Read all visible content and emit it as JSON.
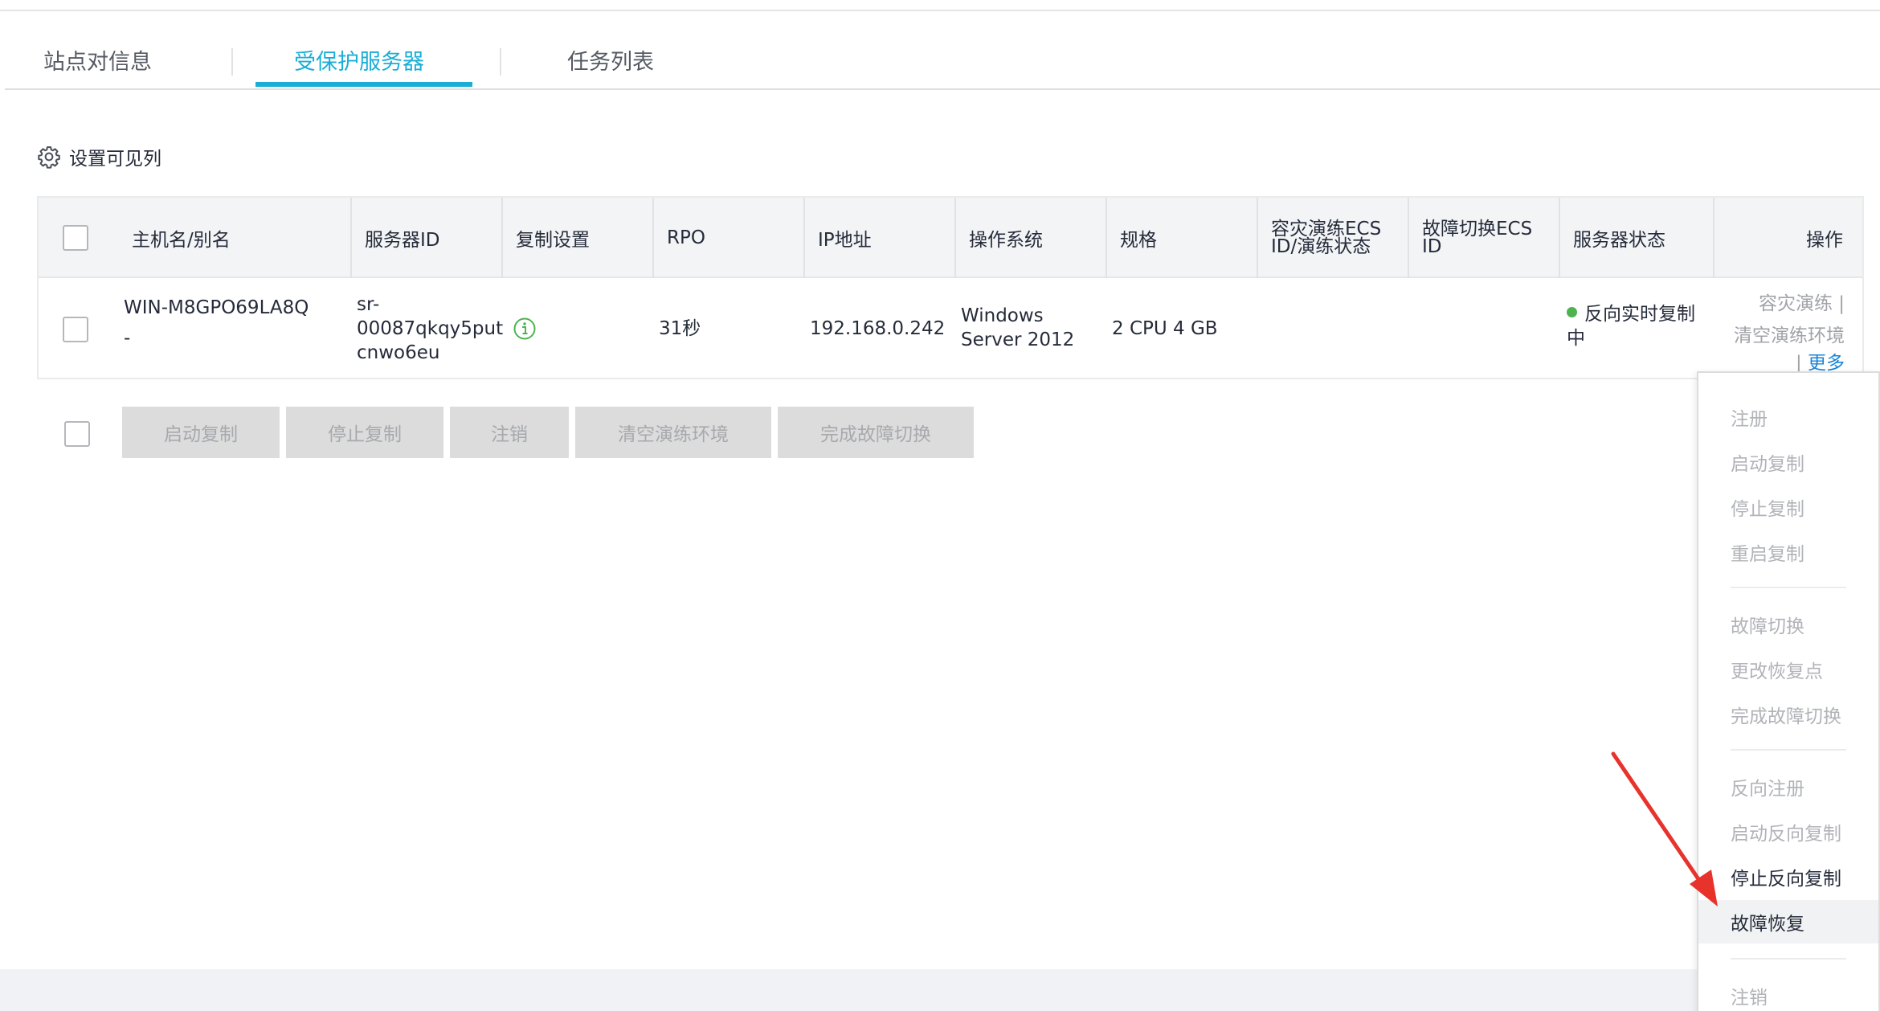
{
  "tabs": [
    {
      "label": "站点对信息"
    },
    {
      "label": "受保护服务器"
    },
    {
      "label": "任务列表"
    }
  ],
  "toolbar": {
    "settings_label": "设置可见列",
    "settings_icon": "gear-icon"
  },
  "table": {
    "headers": {
      "hostname": "主机名/别名",
      "server_id": "服务器ID",
      "replication": "复制设置",
      "rpo": "RPO",
      "ip": "IP地址",
      "os": "操作系统",
      "spec": "规格",
      "drill_ecs": "容灾演练ECS ID/演练状态",
      "failover_ecs": "故障切换ECS ID",
      "status": "服务器状态",
      "actions": "操作"
    },
    "row": {
      "hostname": "WIN-M8GPO69LA8Q",
      "alias": "-",
      "server_id_line1": "sr-",
      "server_id_line2": "00087qkqy5put",
      "server_id_line3": "cnwo6eu",
      "replication_icon": "info-icon",
      "rpo": "31秒",
      "ip": "192.168.0.242",
      "os_line1": "Windows",
      "os_line2": "Server 2012",
      "spec": "2 CPU 4 GB",
      "drill_ecs": "",
      "failover_ecs": "",
      "status_line1": "反向实时复制",
      "status_line2": "中",
      "status_color": "#4db34f",
      "action_drill": "容灾演练",
      "action_clear": "清空演练环境",
      "action_more": "更多",
      "separator": "|"
    }
  },
  "batch_actions": [
    {
      "label": "启动复制"
    },
    {
      "label": "停止复制"
    },
    {
      "label": "注销"
    },
    {
      "label": "清空演练环境"
    },
    {
      "label": "完成故障切换"
    }
  ],
  "dropdown": {
    "items": [
      {
        "label": "注册",
        "state": "disabled"
      },
      {
        "label": "启动复制",
        "state": "disabled"
      },
      {
        "label": "停止复制",
        "state": "disabled"
      },
      {
        "label": "重启复制",
        "state": "disabled"
      },
      {
        "label": "故障切换",
        "state": "disabled"
      },
      {
        "label": "更改恢复点",
        "state": "disabled"
      },
      {
        "label": "完成故障切换",
        "state": "disabled"
      },
      {
        "label": "反向注册",
        "state": "disabled"
      },
      {
        "label": "启动反向复制",
        "state": "disabled"
      },
      {
        "label": "停止反向复制",
        "state": "enabled"
      },
      {
        "label": "故障恢复",
        "state": "highlighted"
      },
      {
        "label": "注销",
        "state": "disabled"
      }
    ]
  },
  "colors": {
    "accent": "#1aaed6",
    "link_blue": "#1a84d6",
    "annotation_red": "#e8332c",
    "disabled_text": "#b1b3b8"
  }
}
